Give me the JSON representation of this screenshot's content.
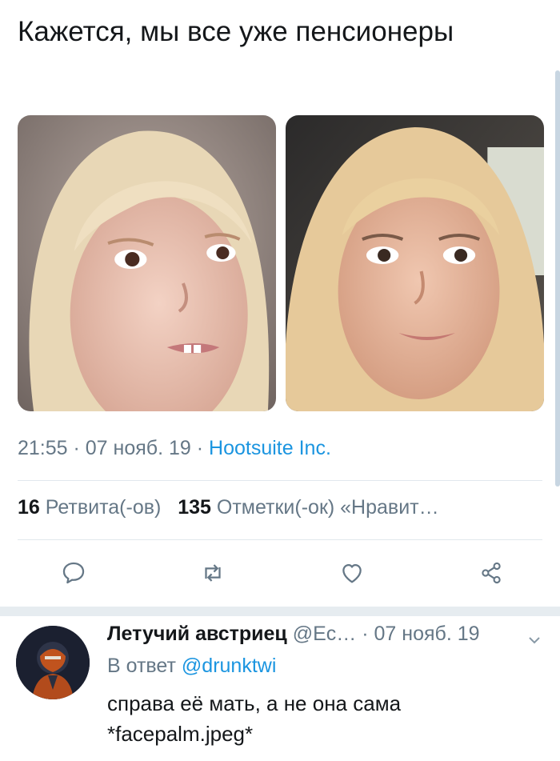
{
  "tweet": {
    "text": "Кажется, мы все уже пенсионеры",
    "time": "21:55",
    "sep1": " · ",
    "date": "07 нояб. 19",
    "sep2": " · ",
    "source": "Hootsuite Inc.",
    "retweets_count": "16",
    "retweets_label": "Ретвита(-ов)",
    "likes_count": "135",
    "likes_label": "Отметки(-ок) «Нравит…"
  },
  "actions": {
    "icons": [
      "reply-icon",
      "retweet-icon",
      "like-icon",
      "share-icon"
    ]
  },
  "reply": {
    "name": "Летучий австриец",
    "handle": "@Ec…",
    "sep": " · ",
    "date": "07 нояб. 19",
    "in_reply_label": "В ответ ",
    "mention": "@drunktwi",
    "body_line1": "справа её мать, а не она сама",
    "body_line2": "*facepalm.jpeg*"
  },
  "colors": {
    "link": "#1b95e0",
    "secondary_text": "#657786",
    "primary_text": "#14171a",
    "divider": "#e1e8ed"
  }
}
